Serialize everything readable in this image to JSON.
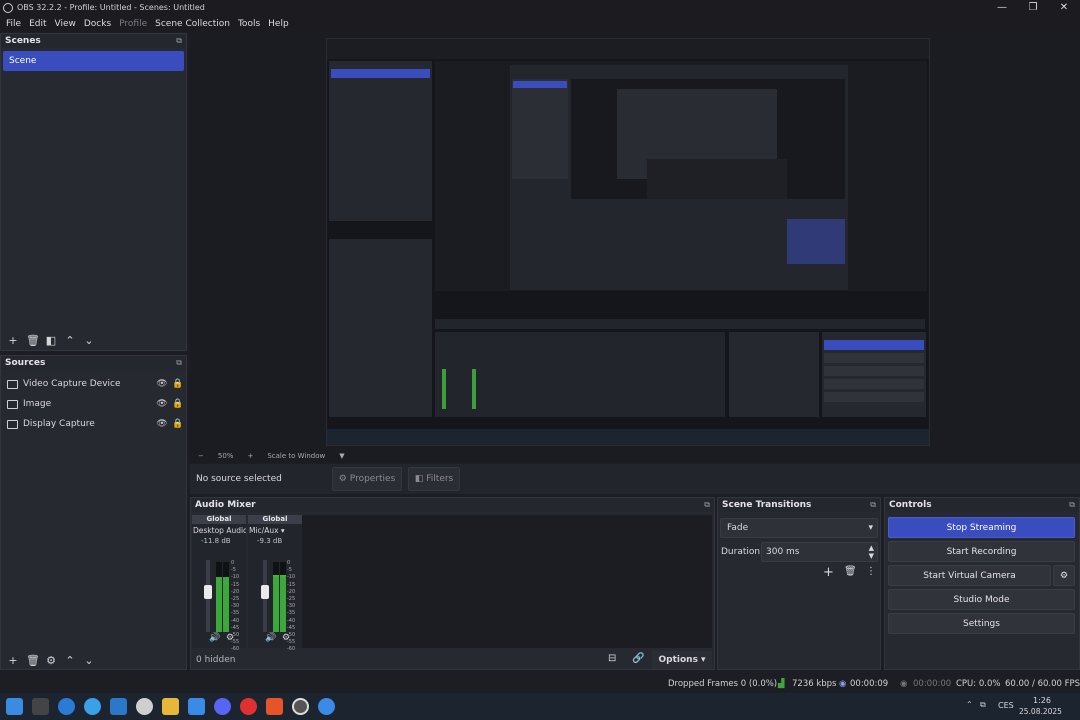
{
  "window": {
    "title": "OBS 32.2.2 - Profile: Untitled - Scenes: Untitled",
    "minimize": "—",
    "maximize": "❐",
    "close": "✕"
  },
  "menu": [
    "File",
    "Edit",
    "View",
    "Docks",
    "Profile",
    "Scene Collection",
    "Tools",
    "Help"
  ],
  "scenes": {
    "title": "Scenes",
    "items": [
      "Scene"
    ]
  },
  "sources": {
    "title": "Sources",
    "items": [
      "Video Capture Device",
      "Image",
      "Display Capture"
    ]
  },
  "preview": {
    "zoom": "50%",
    "scale_label": "Scale to Window"
  },
  "context": {
    "no_source": "No source selected",
    "properties": "Properties",
    "filters": "Filters"
  },
  "mixer": {
    "title": "Audio Mixer",
    "channels": [
      {
        "tag": "Global",
        "name": "Desktop Audio",
        "db": "-11.8 dB",
        "level": 0.78,
        "volume": 0.55
      },
      {
        "tag": "Global",
        "name": "Mic/Aux",
        "db": "-9.3 dB",
        "level": 0.82,
        "volume": 0.55
      }
    ],
    "scale": [
      "0",
      "-5",
      "-10",
      "-15",
      "-20",
      "-25",
      "-30",
      "-35",
      "-40",
      "-45",
      "-50",
      "-55",
      "-60"
    ],
    "hidden": "0 hidden",
    "options": "Options"
  },
  "transitions": {
    "title": "Scene Transitions",
    "selected": "Fade",
    "duration_label": "Duration",
    "duration_value": "300 ms"
  },
  "controls": {
    "title": "Controls",
    "stop_streaming": "Stop Streaming",
    "start_recording": "Start Recording",
    "start_virtual_camera": "Start Virtual Camera",
    "studio_mode": "Studio Mode",
    "settings": "Settings"
  },
  "status": {
    "dropped": "Dropped Frames 0 (0.0%)",
    "bitrate": "7236 kbps",
    "stream_time": "00:00:09",
    "rec_time": "00:00:00",
    "cpu": "CPU: 0.0%",
    "fps": "60.00 / 60.00 FPS"
  },
  "taskbar": {
    "lang": "CES",
    "time": "1:26",
    "date": "25.08.2025"
  },
  "colors": {
    "accent": "#3a4dbf",
    "panel": "#272930",
    "background": "#1d1e25"
  }
}
